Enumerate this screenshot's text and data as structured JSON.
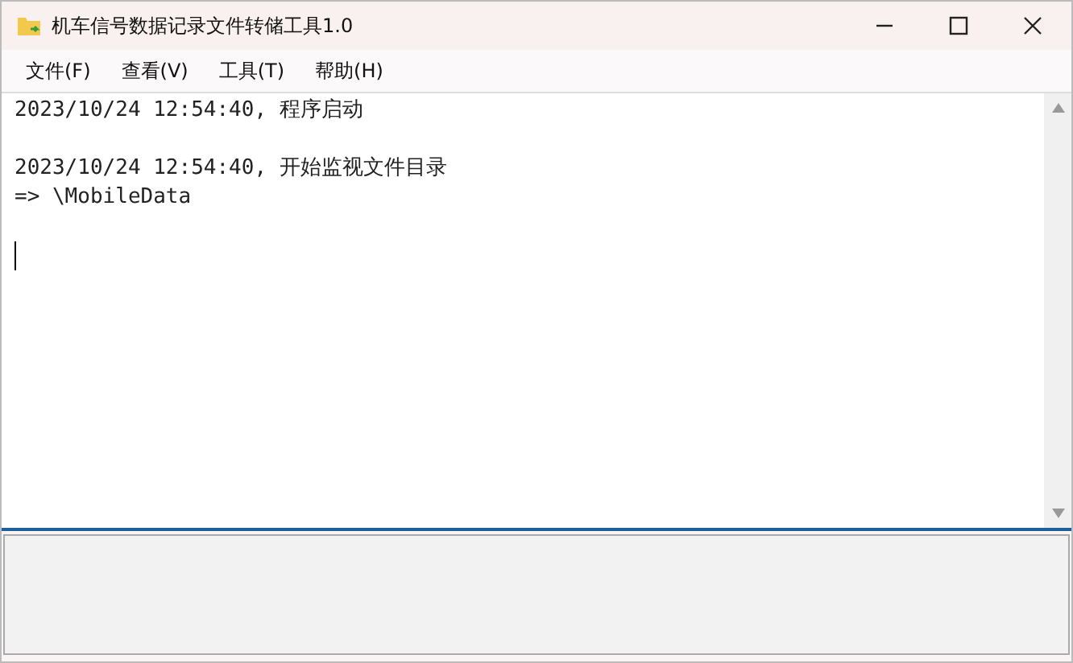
{
  "window": {
    "title": "机车信号数据记录文件转储工具1.0"
  },
  "menu": [
    "文件(F)",
    "查看(V)",
    "工具(T)",
    "帮助(H)"
  ],
  "log": [
    {
      "lines": [
        "2023/10/24 12:54:40, 程序启动"
      ]
    },
    {
      "lines": [
        "2023/10/24 12:54:40, 开始监视文件目录",
        "=> \\MobileData"
      ]
    }
  ]
}
